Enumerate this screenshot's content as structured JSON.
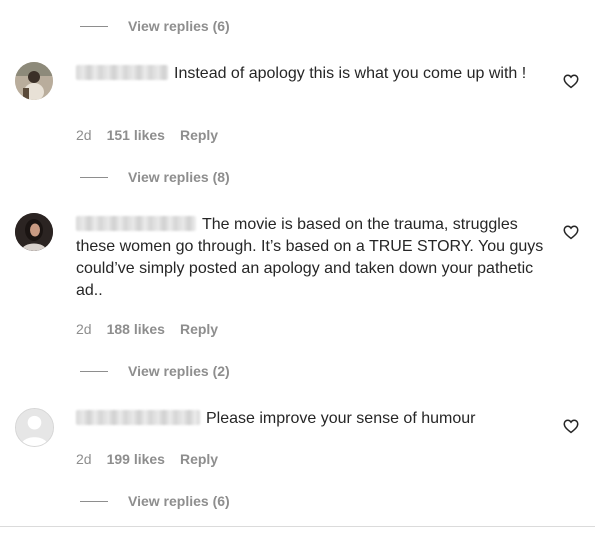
{
  "thread": {
    "top_view_replies": "View replies (6)",
    "comments": [
      {
        "text": "Instead of apology this is what you come up with !",
        "time": "2d",
        "likes": "151 likes",
        "reply": "Reply",
        "view_replies": "View replies (8)",
        "avatar_icon": "profile-photo"
      },
      {
        "text": "The movie is based on the trauma, struggles these women go through. It’s based on a TRUE STORY. You guys could’ve simply posted an apology and taken down your pathetic ad..",
        "time": "2d",
        "likes": "188 likes",
        "reply": "Reply",
        "view_replies": "View replies (2)",
        "avatar_icon": "profile-photo"
      },
      {
        "text": "Please improve your sense of humour",
        "time": "2d",
        "likes": "199 likes",
        "reply": "Reply",
        "view_replies": "View replies (6)",
        "avatar_icon": "default-avatar-icon"
      }
    ]
  },
  "icons": {
    "like": "heart-outline-icon"
  },
  "colors": {
    "text": "#262626",
    "secondary": "#8e8e8e",
    "divider": "#dbdbdb"
  }
}
